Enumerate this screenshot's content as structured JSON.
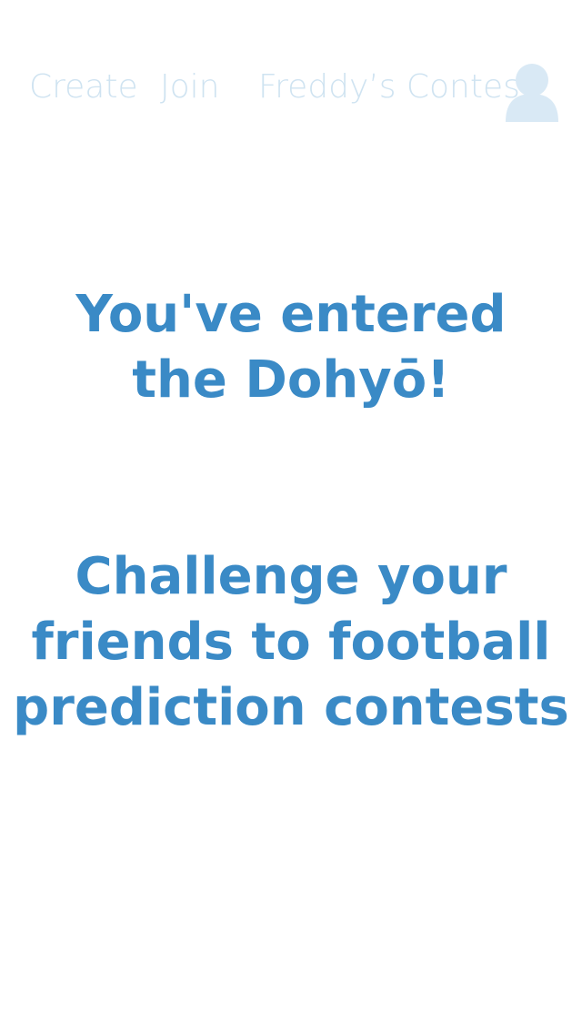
{
  "nav": {
    "create_label": "Create",
    "join_label": "Join",
    "contest_label": "Freddy’s Contest",
    "avatar_icon": "user-avatar-icon"
  },
  "hero": {
    "title_lines": [
      "You've entered",
      "the Dohyō!"
    ],
    "subtitle_lines": [
      "Challenge your",
      "friends to football",
      "prediction contests"
    ]
  },
  "colors": {
    "nav_text": "#cfe3f1",
    "avatar": "#d9e9f5",
    "accent": "#3a8ac6",
    "background": "#ffffff"
  }
}
